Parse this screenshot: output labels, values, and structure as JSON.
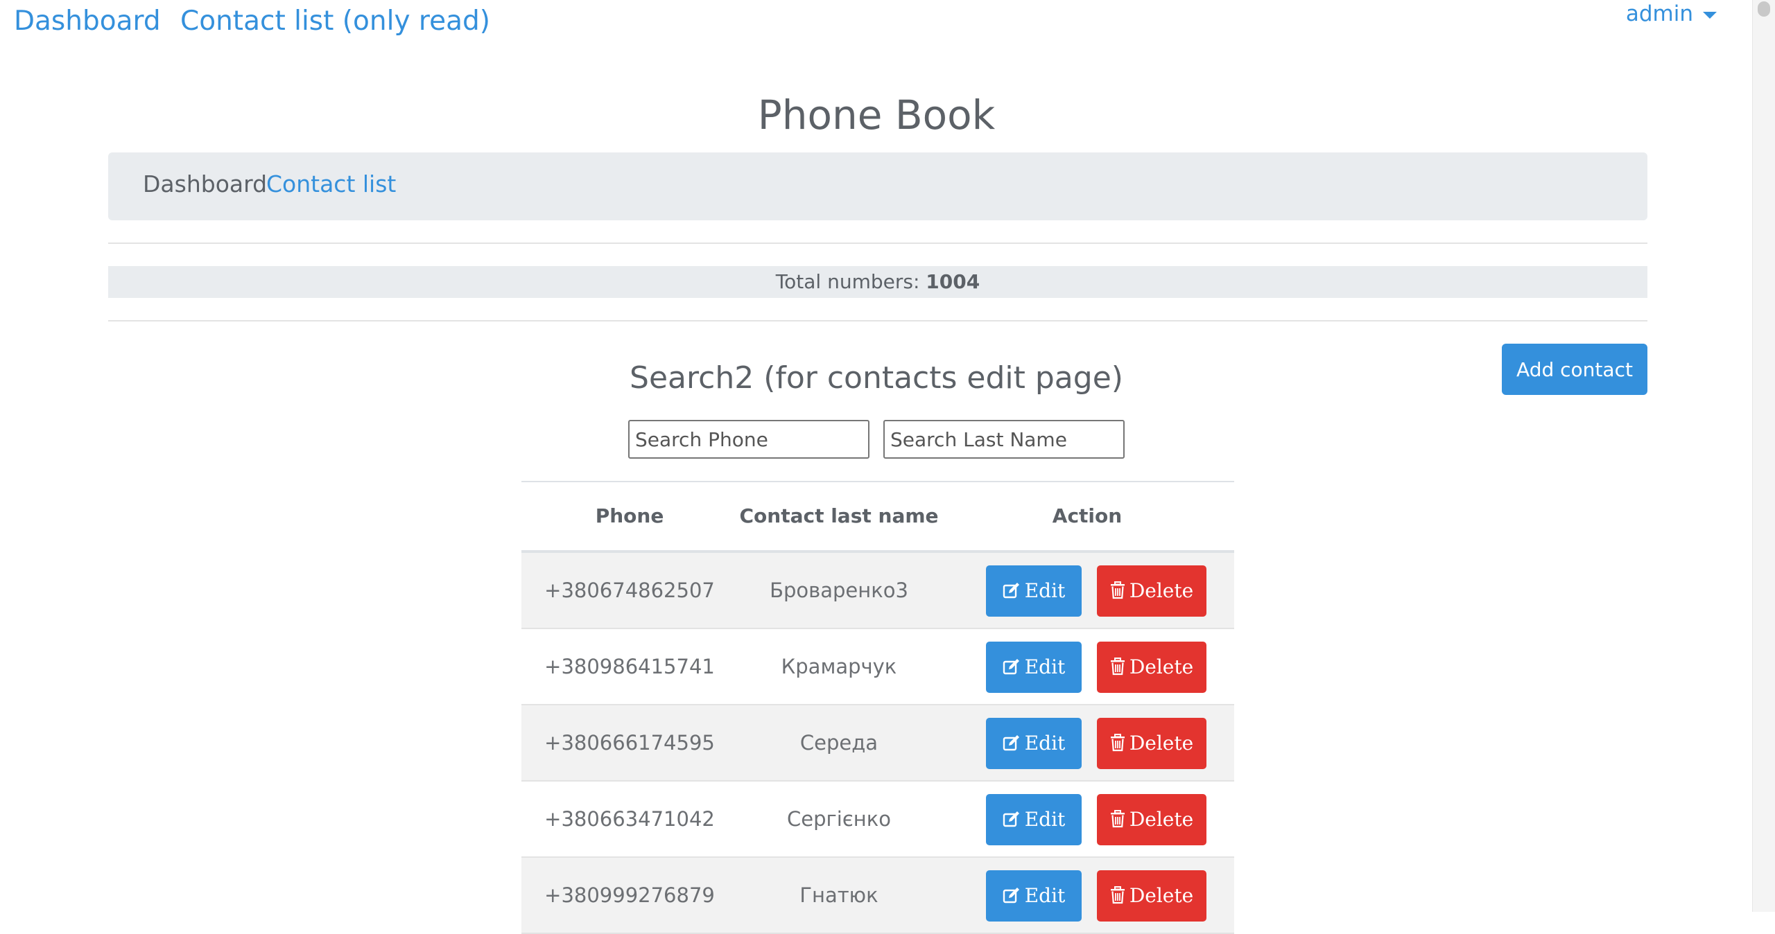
{
  "nav": {
    "dashboard": "Dashboard",
    "contact_list_readonly": "Contact list (only read)",
    "user": "admin"
  },
  "page": {
    "title": "Phone Book"
  },
  "breadcrumb": {
    "dashboard": "Dashboard",
    "contact_list": "Contact list"
  },
  "stats": {
    "total_label": "Total numbers:",
    "total_value": "1004"
  },
  "actions": {
    "add_contact": "Add contact"
  },
  "search": {
    "title": "Search2 (for contacts edit page)",
    "phone_placeholder": "Search Phone",
    "lastname_placeholder": "Search Last Name"
  },
  "table": {
    "headers": {
      "phone": "Phone",
      "last_name": "Contact last name",
      "action": "Action"
    },
    "edit_label": "Edit",
    "delete_label": "Delete",
    "rows": [
      {
        "phone": "+380674862507",
        "last_name": "Броваренко3"
      },
      {
        "phone": "+380986415741",
        "last_name": "Крамарчук"
      },
      {
        "phone": "+380666174595",
        "last_name": "Середа"
      },
      {
        "phone": "+380663471042",
        "last_name": "Сергієнко"
      },
      {
        "phone": "+380999276879",
        "last_name": "Гнатюк"
      }
    ]
  },
  "colors": {
    "primary": "#3490dc",
    "danger": "#e3342f",
    "breadcrumb_bg": "#e9ecef",
    "text": "#5c6167"
  }
}
